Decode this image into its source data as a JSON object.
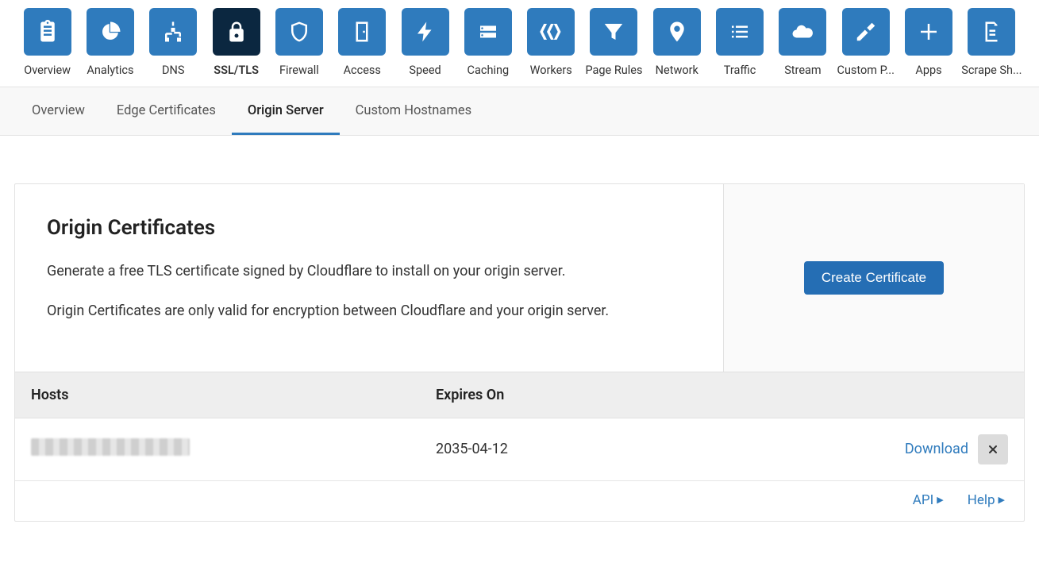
{
  "nav": [
    {
      "id": "overview",
      "label": "Overview"
    },
    {
      "id": "analytics",
      "label": "Analytics"
    },
    {
      "id": "dns",
      "label": "DNS"
    },
    {
      "id": "ssl",
      "label": "SSL/TLS",
      "active": true
    },
    {
      "id": "firewall",
      "label": "Firewall"
    },
    {
      "id": "access",
      "label": "Access"
    },
    {
      "id": "speed",
      "label": "Speed"
    },
    {
      "id": "caching",
      "label": "Caching"
    },
    {
      "id": "workers",
      "label": "Workers"
    },
    {
      "id": "pagerules",
      "label": "Page Rules"
    },
    {
      "id": "network",
      "label": "Network"
    },
    {
      "id": "traffic",
      "label": "Traffic"
    },
    {
      "id": "stream",
      "label": "Stream"
    },
    {
      "id": "customp",
      "label": "Custom P..."
    },
    {
      "id": "apps",
      "label": "Apps"
    },
    {
      "id": "scrape",
      "label": "Scrape Sh..."
    }
  ],
  "subnav": [
    {
      "label": "Overview"
    },
    {
      "label": "Edge Certificates"
    },
    {
      "label": "Origin Server",
      "active": true
    },
    {
      "label": "Custom Hostnames"
    }
  ],
  "section": {
    "title": "Origin Certificates",
    "desc1": "Generate a free TLS certificate signed by Cloudflare to install on your origin server.",
    "desc2": "Origin Certificates are only valid for encryption between Cloudflare and your origin server.",
    "cta": "Create Certificate"
  },
  "table": {
    "headers": {
      "hosts": "Hosts",
      "expires": "Expires On"
    },
    "rows": [
      {
        "hosts": "[redacted]",
        "expires": "2035-04-12",
        "download": "Download"
      }
    ]
  },
  "footer": {
    "api": "API",
    "help": "Help"
  }
}
